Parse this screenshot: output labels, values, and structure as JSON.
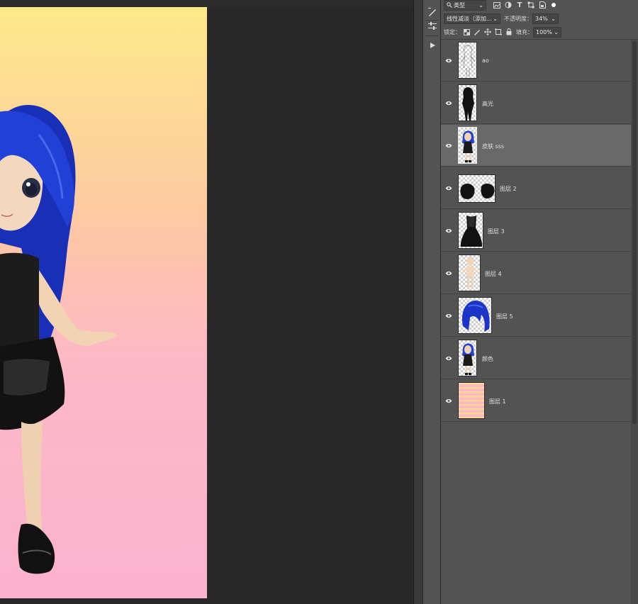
{
  "canvas": {
    "gradient_top": "#fde98a",
    "gradient_bottom": "#fcb2cf",
    "character_hair_color": "#1b35c8",
    "character_outfit_color": "#1a1a1a",
    "character_skin_color": "#f2d3b4"
  },
  "toolstrip": {
    "tools": [
      "brush-settings-icon",
      "adjustments-icon",
      "play-icon"
    ]
  },
  "layers_panel": {
    "filter_kind": "类型",
    "filter_icons": [
      "image-filter-icon",
      "adjustment-filter-icon",
      "type-filter-icon",
      "shape-filter-icon",
      "smart-object-filter-icon",
      "filter-toggle-icon"
    ],
    "blend_mode": "线性减淡（添加...",
    "opacity_label": "不透明度：",
    "opacity_value": "34%",
    "lock_label": "锁定：",
    "lock_icons": [
      "lock-transparent-icon",
      "lock-image-icon",
      "lock-position-icon",
      "lock-artboard-icon",
      "lock-all-icon"
    ],
    "fill_label": "填充：",
    "fill_value": "100%",
    "layers": [
      {
        "name": "ao",
        "visible": true,
        "selected": false,
        "thumb": "sketch"
      },
      {
        "name": "高光",
        "visible": true,
        "selected": false,
        "thumb": "silhouette"
      },
      {
        "name": "皮肤 sss",
        "visible": true,
        "selected": true,
        "thumb": "character"
      },
      {
        "name": "图层 2",
        "visible": true,
        "selected": false,
        "thumb": "shoes"
      },
      {
        "name": "图层 3",
        "visible": true,
        "selected": false,
        "thumb": "dress"
      },
      {
        "name": "图层 4",
        "visible": true,
        "selected": false,
        "thumb": "skin"
      },
      {
        "name": "图层 5",
        "visible": true,
        "selected": false,
        "thumb": "hair"
      },
      {
        "name": "颜色",
        "visible": true,
        "selected": false,
        "thumb": "character"
      },
      {
        "name": "图层 1",
        "visible": true,
        "selected": false,
        "thumb": "gradient"
      }
    ]
  }
}
